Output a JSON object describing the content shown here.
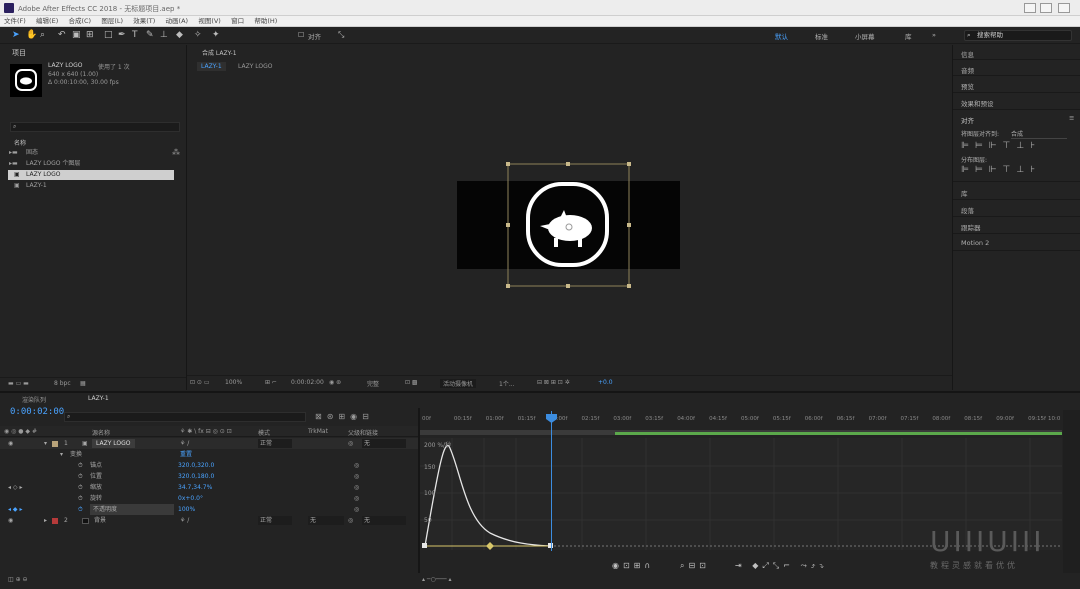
{
  "window": {
    "title": "Adobe After Effects CC 2018 - 无标题项目.aep *"
  },
  "menu": [
    "文件(F)",
    "编辑(E)",
    "合成(C)",
    "图层(L)",
    "效果(T)",
    "动画(A)",
    "视图(V)",
    "窗口",
    "帮助(H)"
  ],
  "toolbar": {
    "snap_label": "对齐",
    "workspaces": [
      "默认",
      "标准",
      "小屏幕",
      "库"
    ],
    "search_placeholder": "搜索帮助"
  },
  "project": {
    "title": "项目",
    "item_name": "LAZY LOGO",
    "item_used": "使用了 1 次",
    "item_size": "640 x 640 (1.00)",
    "item_duration": "Δ 0:00:10:00, 30.00 fps",
    "column_name": "名称",
    "rows": [
      {
        "name": "固态",
        "type": "folder"
      },
      {
        "name": "LAZY LOGO 个图层",
        "type": "folder"
      },
      {
        "name": "LAZY LOGO",
        "type": "comp",
        "selected": true
      },
      {
        "name": "LAZY-1",
        "type": "comp"
      }
    ],
    "footer_bpc": "8 bpc"
  },
  "composition": {
    "panel_title": "合成 LAZY-1",
    "breadcrumb": [
      "LAZY-1",
      "LAZY LOGO"
    ],
    "zoom": "100%",
    "timecode": "0:00:02:00",
    "quality": "完整",
    "camera": "活动摄像机",
    "views": "1个...",
    "exposure": "+0.0"
  },
  "right_panel": {
    "items": [
      "信息",
      "音频",
      "预览",
      "效果和预设",
      "对齐",
      "库",
      "段落",
      "跟踪器",
      "Motion 2"
    ],
    "align_to_label": "将图层对齐到:",
    "align_to_value": "合成",
    "distribute_label": "分布图层:"
  },
  "timeline": {
    "tabs": [
      "渲染队列",
      "LAZY-1"
    ],
    "current_time": "0:00:02:00",
    "search_placeholder": "",
    "columns": {
      "source_name": "源名称",
      "mode": "模式",
      "trkmat": "TrkMat",
      "parent": "父级和链接"
    },
    "layers": [
      {
        "index": "1",
        "name": "LAZY LOGO",
        "mode": "正常",
        "parent": "无",
        "color": "#b8a37a"
      },
      {
        "index": "2",
        "name": "背景",
        "mode": "正常",
        "trkmat": "无",
        "parent": "无",
        "color": "#b53a3a"
      }
    ],
    "transform": {
      "label": "变换",
      "reset": "重置",
      "props": [
        {
          "name": "锚点",
          "value": "320.0,320.0"
        },
        {
          "name": "位置",
          "value": "320.0,180.0"
        },
        {
          "name": "缩放",
          "value": "34.7,34.7%"
        },
        {
          "name": "旋转",
          "value": "0x+0.0°"
        },
        {
          "name": "不透明度",
          "value": "100%"
        }
      ]
    },
    "ruler_ticks": [
      "00f",
      "00:15f",
      "01:00f",
      "01:15f",
      "02:00f",
      "02:15f",
      "03:00f",
      "03:15f",
      "04:00f",
      "04:15f",
      "05:00f",
      "05:15f",
      "06:00f",
      "06:15f",
      "07:00f",
      "07:15f",
      "08:00f",
      "08:15f",
      "09:00f",
      "09:15f",
      "10:0"
    ],
    "graph_labels": [
      "200 %/秒",
      "150",
      "100",
      "50"
    ]
  },
  "watermark": {
    "logo": "UIIIUIII",
    "text": "教程灵感就看优优"
  }
}
